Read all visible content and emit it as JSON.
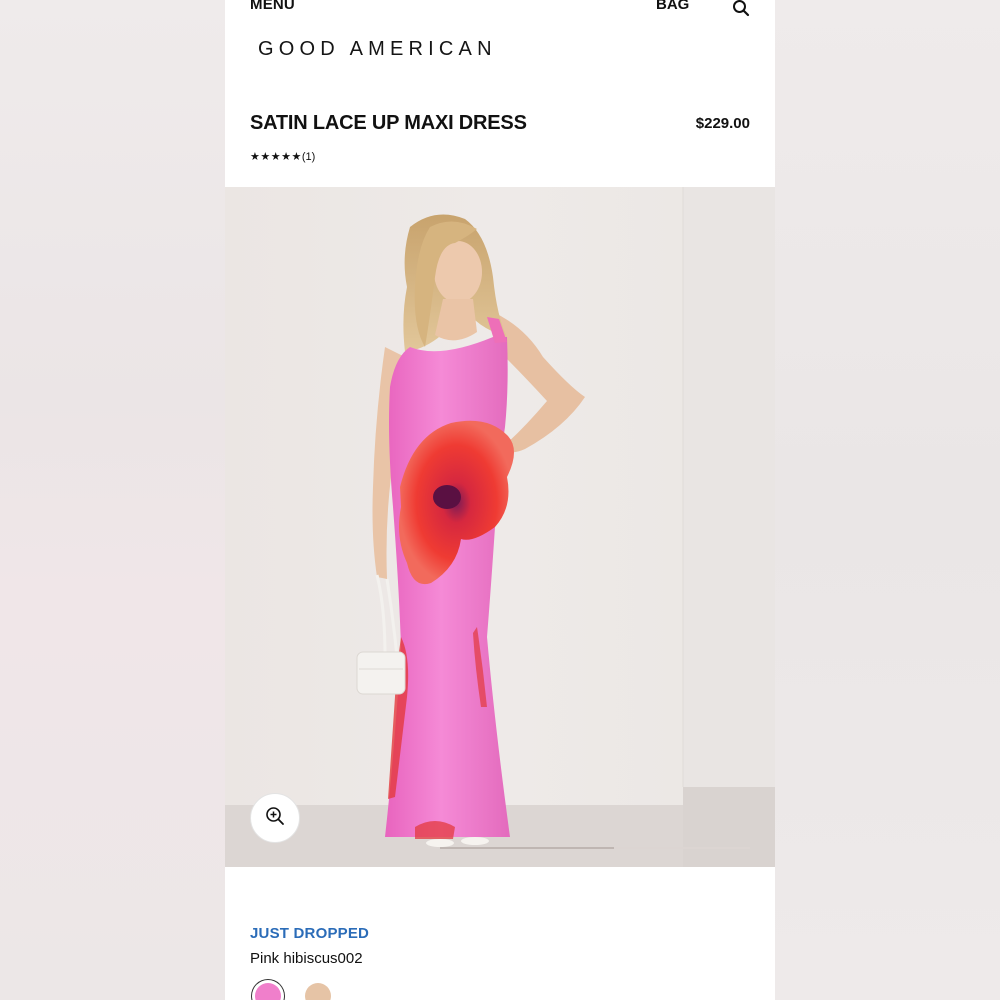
{
  "header": {
    "menu_label": "MENU",
    "bag_label": "BAG",
    "search_icon": "search-icon",
    "brand": "GOOD AMERICAN"
  },
  "product": {
    "title": "SATIN LACE UP MAXI DRESS",
    "price": "$229.00",
    "rating_stars": "★★★★★",
    "rating_count": "(1)",
    "rating_value": 5,
    "badge": "JUST DROPPED",
    "color_name": "Pink hibiscus002",
    "swatches": [
      {
        "name": "pink-hibiscus",
        "color": "#f07fcb",
        "selected": true
      },
      {
        "name": "nude",
        "color": "#e6c4a6",
        "selected": false
      }
    ]
  },
  "gallery": {
    "zoom_icon": "zoom-in-icon",
    "progress": 0.56
  },
  "colors": {
    "badge": "#2b6cb8",
    "dress_pink": "#f27fcf",
    "hibiscus_red": "#e8323a"
  }
}
